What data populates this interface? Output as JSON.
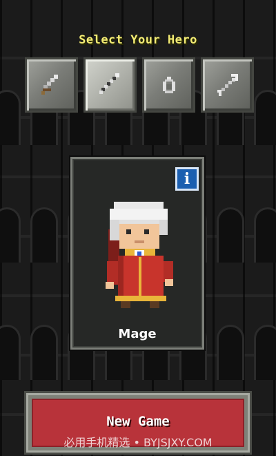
{
  "screen": {
    "title": "Select Your Hero"
  },
  "classes": [
    {
      "id": "warrior",
      "icon": "sword-icon",
      "selected": false
    },
    {
      "id": "mage",
      "icon": "staff-icon",
      "selected": true
    },
    {
      "id": "rogue",
      "icon": "ring-icon",
      "selected": false
    },
    {
      "id": "huntress",
      "icon": "arrow-icon",
      "selected": false
    }
  ],
  "hero": {
    "name": "Mage",
    "info_icon": "i"
  },
  "actions": {
    "new_game_label": "New Game"
  },
  "watermark": "必用手机精选 • BYJSJXY.COM",
  "colors": {
    "title": "#f3ec74",
    "new_game_button": "#b8333a",
    "info_button": "#1b5fb0"
  }
}
